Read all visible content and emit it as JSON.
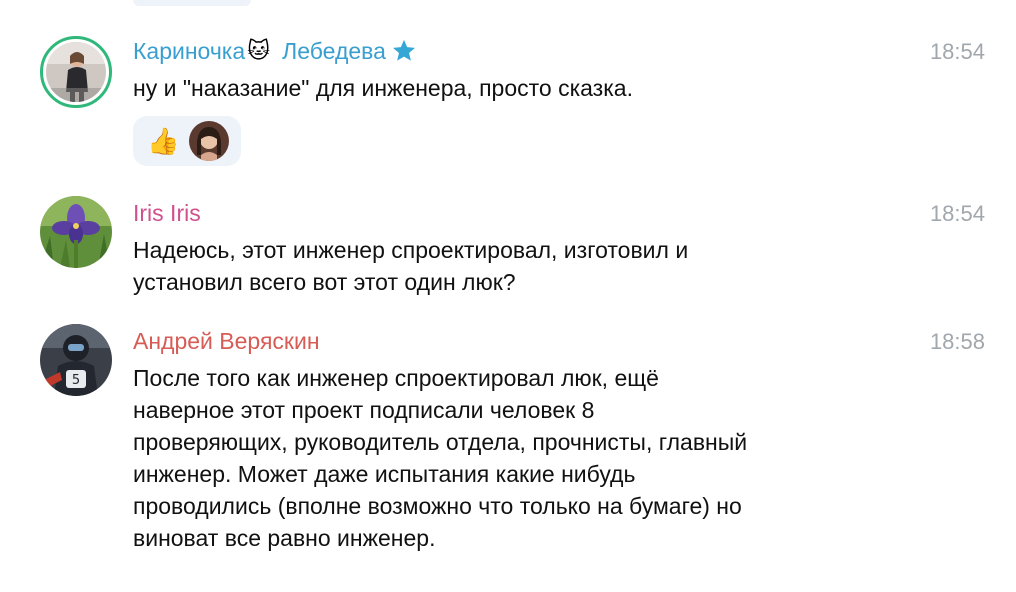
{
  "messages": [
    {
      "author": "Кариночка",
      "author_badge": "🐱",
      "author_last": "Лебедева",
      "author_color": "#3a9fd0",
      "time": "18:54",
      "text": "ну и \"наказание\" для инженера, просто сказка.",
      "reaction_emoji": "👍"
    },
    {
      "author": "Iris Iris",
      "author_color": "#d0508e",
      "time": "18:54",
      "text": "Надеюсь, этот инженер спроектировал, изготовил и\nустановил всего вот этот один люк?"
    },
    {
      "author": "Андрей Веряскин",
      "author_color": "#d65c55",
      "time": "18:58",
      "text": "После того как инженер спроектировал люк, ещё\nнаверное этот проект подписали человек 8\nпроверяющих, руководитель отдела, прочнисты, главный\nинженер. Может даже испытания какие нибудь\nпроводились (вполне возможно что только на бумаге) но\nвиноват все равно инженер."
    }
  ]
}
